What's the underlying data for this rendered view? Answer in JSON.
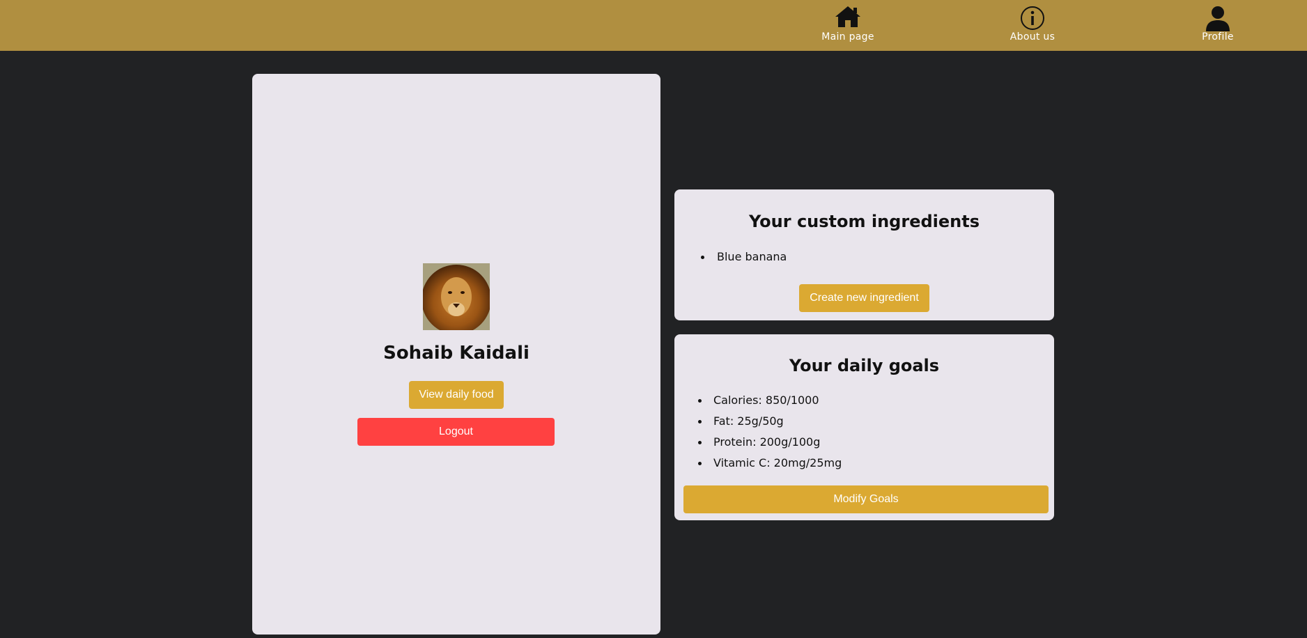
{
  "nav": {
    "main_page": "Main page",
    "about_us": "About us",
    "profile": "Profile"
  },
  "colors": {
    "topbar": "#b08f40",
    "background": "#212224",
    "card": "#e9e5ec",
    "button_gold": "#dba932",
    "button_red": "#ff4141"
  },
  "profile": {
    "name": "Sohaib Kaidali",
    "avatar_icon": "lion-avatar",
    "view_daily_food": "View daily food",
    "logout": "Logout"
  },
  "ingredients": {
    "title": "Your custom ingredients",
    "items": [
      "Blue banana"
    ],
    "create_button": "Create new ingredient"
  },
  "goals": {
    "title": "Your daily goals",
    "items": [
      "Calories: 850/1000",
      "Fat: 25g/50g",
      "Protein: 200g/100g",
      "Vitamic C: 20mg/25mg"
    ],
    "modify_button": "Modify Goals"
  }
}
